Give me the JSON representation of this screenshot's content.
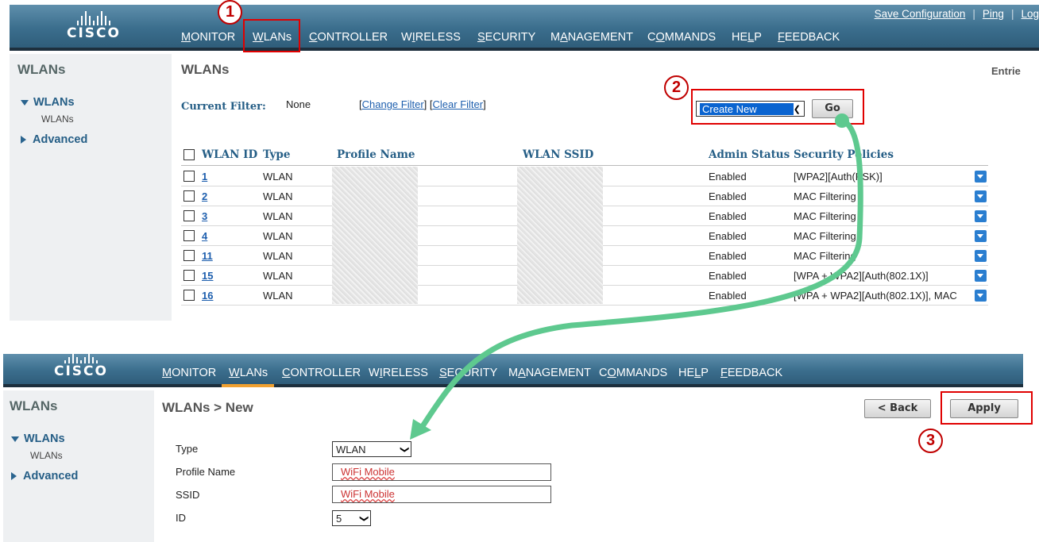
{
  "header1": {
    "logo": "CISCO",
    "menu": [
      "MONITOR",
      "WLANs",
      "CONTROLLER",
      "WIRELESS",
      "SECURITY",
      "MANAGEMENT",
      "COMMANDS",
      "HELP",
      "FEEDBACK"
    ],
    "menu_underline": [
      "M",
      "W",
      "C",
      "I",
      "S",
      "A",
      "O",
      "L",
      "F"
    ],
    "links": {
      "save": "Save Configuration",
      "ping": "Ping",
      "logout": "Log"
    }
  },
  "sidebar1": {
    "title": "WLANs",
    "group": "WLANs",
    "sub": "WLANs",
    "advanced": "Advanced"
  },
  "list_page": {
    "title": "WLANs",
    "entries_label": "Entrie",
    "filter_label": "Current Filter:",
    "filter_value": "None",
    "change_filter": "Change Filter",
    "clear_filter": "Clear Filter",
    "action_select": "Create New",
    "go_button": "Go"
  },
  "table": {
    "headers": [
      "WLAN ID",
      "Type",
      "Profile Name",
      "WLAN SSID",
      "Admin Status",
      "Security Policies"
    ],
    "rows": [
      {
        "id": "1",
        "type": "WLAN",
        "admin": "Enabled",
        "security": "[WPA2][Auth(PSK)]"
      },
      {
        "id": "2",
        "type": "WLAN",
        "admin": "Enabled",
        "security": " MAC Filtering"
      },
      {
        "id": "3",
        "type": "WLAN",
        "admin": "Enabled",
        "security": " MAC Filtering"
      },
      {
        "id": "4",
        "type": "WLAN",
        "admin": "Enabled",
        "security": " MAC Filtering"
      },
      {
        "id": "11",
        "type": "WLAN",
        "admin": "Enabled",
        "security": " MAC Filtering"
      },
      {
        "id": "15",
        "type": "WLAN",
        "admin": "Enabled",
        "security": "[WPA + WPA2][Auth(802.1X)]"
      },
      {
        "id": "16",
        "type": "WLAN",
        "admin": "Enabled",
        "security": "[WPA + WPA2][Auth(802.1X)], MAC"
      }
    ]
  },
  "header2": {
    "logo": "CISCO",
    "menu": [
      "MONITOR",
      "WLANs",
      "CONTROLLER",
      "WIRELESS",
      "SECURITY",
      "MANAGEMENT",
      "COMMANDS",
      "HELP",
      "FEEDBACK"
    ],
    "menu_underline": [
      "M",
      "W",
      "C",
      "I",
      "S",
      "A",
      "O",
      "L",
      "F"
    ]
  },
  "sidebar2": {
    "title": "WLANs",
    "group": "WLANs",
    "sub": "WLANs",
    "advanced": "Advanced"
  },
  "new_page": {
    "title": "WLANs > New",
    "back_button": "< Back",
    "apply_button": "Apply",
    "type_label": "Type",
    "type_value": "WLAN",
    "profile_label": "Profile Name",
    "profile_value": "WiFi Mobile",
    "ssid_label": "SSID",
    "ssid_value": "WiFi Mobile",
    "id_label": "ID",
    "id_value": "5"
  },
  "annotations": {
    "step1": "1",
    "step2": "2",
    "step3": "3"
  },
  "colors": {
    "header": "#3b6e8d",
    "link": "#1e5fae",
    "annotation": "#e00000",
    "arrow": "#5ec98f",
    "active_tab": "#f0a030"
  }
}
